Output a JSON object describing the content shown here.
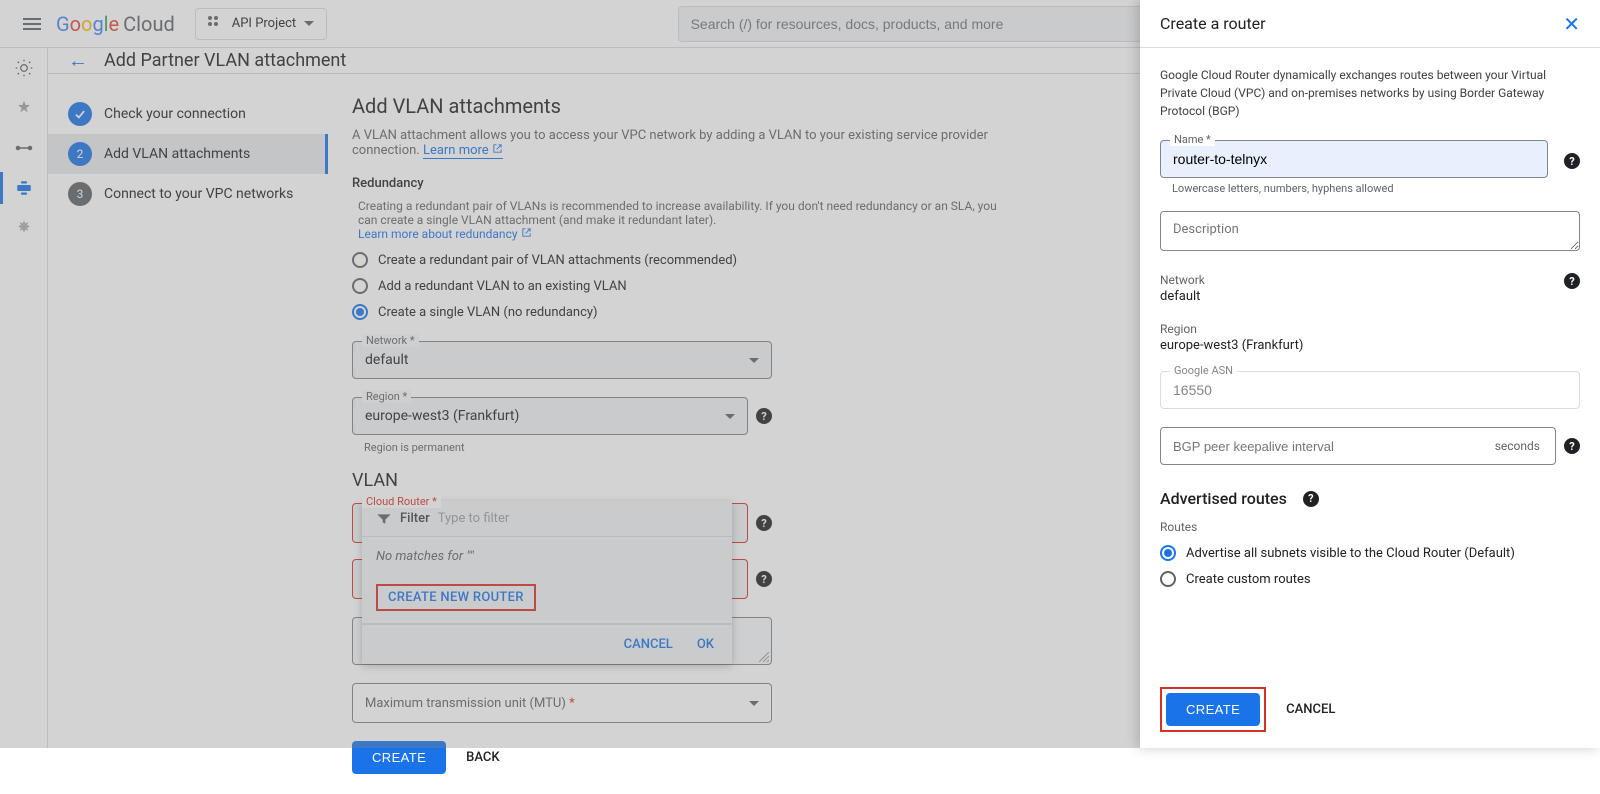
{
  "topbar": {
    "logo_cloud": "Cloud",
    "project": "API Project",
    "search_placeholder": "Search (/) for resources, docs, products, and more",
    "search_button": "Search"
  },
  "page": {
    "title": "Add Partner VLAN attachment"
  },
  "stepper": {
    "step1": "Check your connection",
    "step2": "Add VLAN attachments",
    "step3": "Connect to your VPC networks"
  },
  "form": {
    "title": "Add VLAN attachments",
    "subtitle_pre": "A VLAN attachment allows you to access your VPC network by adding a VLAN to your existing service provider connection. ",
    "subtitle_link": "Learn more",
    "redundancy_head": "Redundancy",
    "redundancy_help": "Creating a redundant pair of VLANs is recommended to increase availability. If you don't need redundancy or an SLA, you can create a single VLAN attachment (and make it redundant later).",
    "redundancy_link": "Learn more about redundancy",
    "radio_pair": "Create a redundant pair of VLAN attachments (recommended)",
    "radio_add": "Add a redundant VLAN to an existing VLAN",
    "radio_single": "Create a single VLAN (no redundancy)",
    "network_label": "Network",
    "network_value": "default",
    "region_label": "Region",
    "region_value": "europe-west3 (Frankfurt)",
    "region_hint": "Region is permanent",
    "vlan_head": "VLAN",
    "cloud_router_label": "Cloud Router *",
    "filter_label": "Filter",
    "filter_placeholder": "Type to filter",
    "no_match": "No matches for \"\"",
    "create_new_router": "CREATE NEW ROUTER",
    "popup_cancel": "CANCEL",
    "popup_ok": "OK",
    "mtu_label": "Maximum transmission unit (MTU)",
    "create_btn": "CREATE",
    "back_btn": "BACK"
  },
  "panel": {
    "title": "Create a router",
    "description": "Google Cloud Router dynamically exchanges routes between your Virtual Private Cloud (VPC) and on-premises networks by using Border Gateway Protocol (BGP)",
    "name_label": "Name *",
    "name_value": "router-to-telnyx",
    "name_hint": "Lowercase letters, numbers, hyphens allowed",
    "desc_placeholder": "Description",
    "network_label": "Network",
    "network_value": "default",
    "region_label": "Region",
    "region_value": "europe-west3 (Frankfurt)",
    "asn_label": "Google ASN",
    "asn_value": "16550",
    "bgp_placeholder": "BGP peer keepalive interval",
    "bgp_unit": "seconds",
    "adv_routes": "Advertised routes",
    "routes_label": "Routes",
    "radio_default": "Advertise all subnets visible to the Cloud Router (Default)",
    "radio_custom": "Create custom routes",
    "create_btn": "CREATE",
    "cancel_btn": "CANCEL"
  }
}
